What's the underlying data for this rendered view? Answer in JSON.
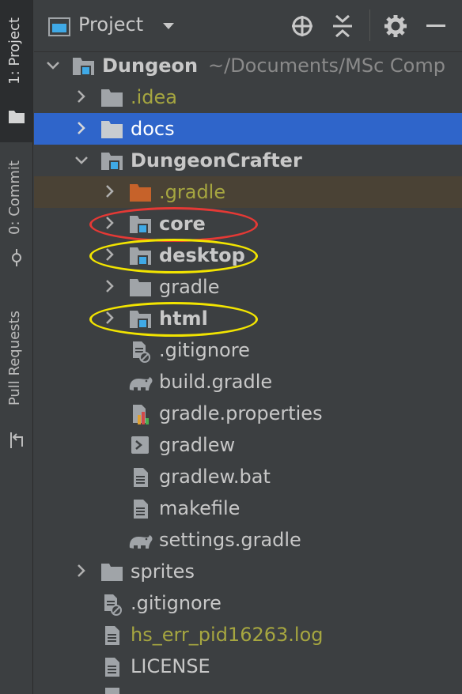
{
  "strip": {
    "project_tab": "1: Project",
    "commit_tab": "0: Commit",
    "pull_tab": "Pull Requests"
  },
  "toolbar": {
    "title": "Project",
    "icons": [
      "locate-icon",
      "collapse-all-icon",
      "gear-icon",
      "minimize-icon"
    ]
  },
  "tree": {
    "root": {
      "name": "Dungeon",
      "path": "~/Documents/MSc Comp"
    },
    "idea": ".idea",
    "docs": "docs",
    "dungeoncrafter": "DungeonCrafter",
    "gradle_hidden": ".gradle",
    "core": "core",
    "desktop": "desktop",
    "gradle": "gradle",
    "html": "html",
    "gitignore_inner": ".gitignore",
    "build_gradle": "build.gradle",
    "gradle_properties": "gradle.properties",
    "gradlew": "gradlew",
    "gradlew_bat": "gradlew.bat",
    "makefile": "makefile",
    "settings_gradle": "settings.gradle",
    "sprites": "sprites",
    "gitignore_outer": ".gitignore",
    "hs_err": "hs_err_pid16263.log",
    "license": "LICENSE"
  },
  "colors": {
    "background": "#3c3f41",
    "selection": "#2f65ca",
    "excluded_row": "#4a4235",
    "red_highlight": "#e53935",
    "yellow_highlight": "#f2e400",
    "folder": "#a0a4a8",
    "module_marker": "#3fa9e6",
    "excluded_folder": "#c6622a",
    "olive_text": "#a6a640"
  }
}
